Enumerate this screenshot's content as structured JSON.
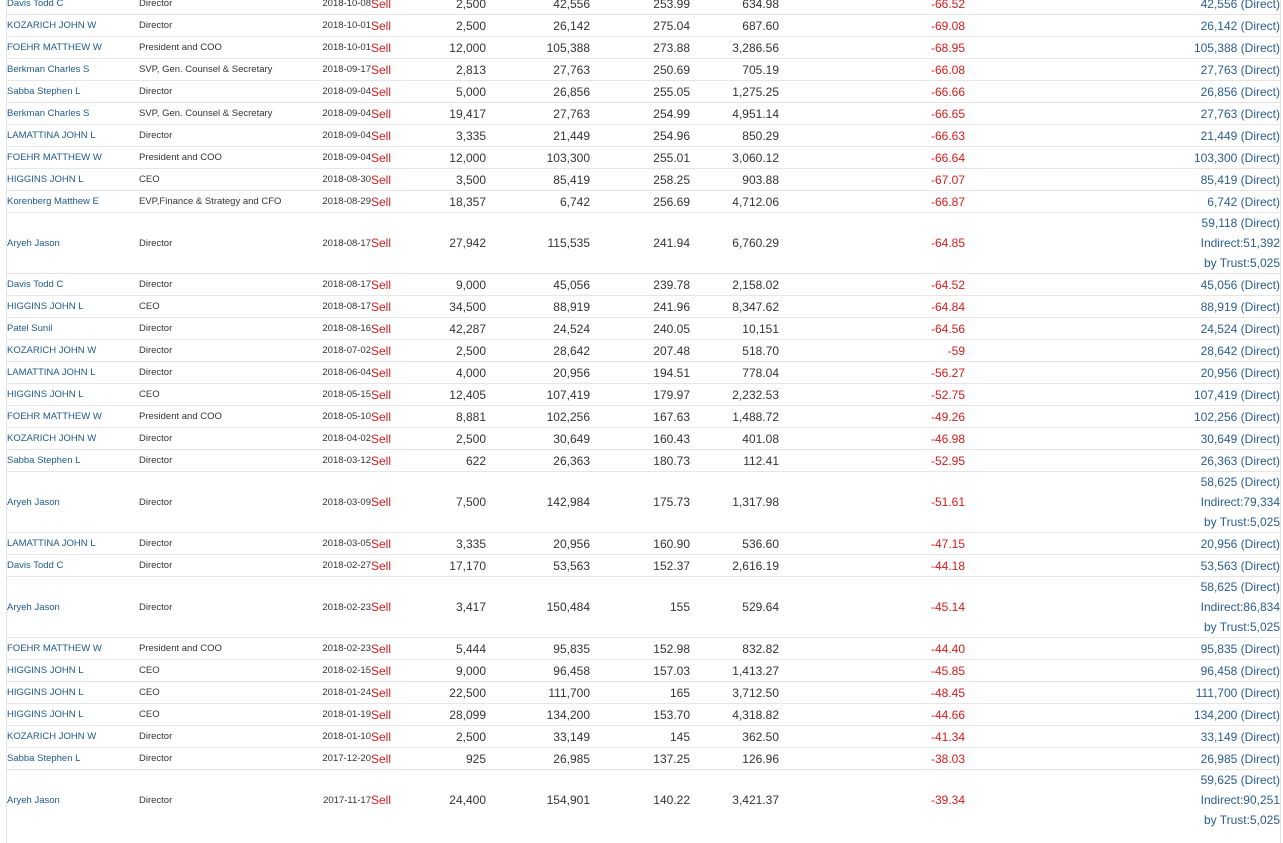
{
  "table": {
    "rows": [
      {
        "insider": "Davis Todd C",
        "relationship": "Director",
        "date": "2018-10-08",
        "type": "Sell",
        "shares": "2,500",
        "total": "42,556",
        "price": "253.99",
        "value": "634.98",
        "change": "-66.52",
        "owned": [
          "42,556 (Direct)"
        ]
      },
      {
        "insider": "KOZARICH JOHN W",
        "relationship": "Director",
        "date": "2018-10-01",
        "type": "Sell",
        "shares": "2,500",
        "total": "26,142",
        "price": "275.04",
        "value": "687.60",
        "change": "-69.08",
        "owned": [
          "26,142 (Direct)"
        ]
      },
      {
        "insider": "FOEHR MATTHEW W",
        "relationship": "President and COO",
        "date": "2018-10-01",
        "type": "Sell",
        "shares": "12,000",
        "total": "105,388",
        "price": "273.88",
        "value": "3,286.56",
        "change": "-68.95",
        "owned": [
          "105,388 (Direct)"
        ]
      },
      {
        "insider": "Berkman Charles S",
        "relationship": "SVP, Gen. Counsel & Secretary",
        "date": "2018-09-17",
        "type": "Sell",
        "shares": "2,813",
        "total": "27,763",
        "price": "250.69",
        "value": "705.19",
        "change": "-66.08",
        "owned": [
          "27,763 (Direct)"
        ]
      },
      {
        "insider": "Sabba Stephen L",
        "relationship": "Director",
        "date": "2018-09-04",
        "type": "Sell",
        "shares": "5,000",
        "total": "26,856",
        "price": "255.05",
        "value": "1,275.25",
        "change": "-66.66",
        "owned": [
          "26,856 (Direct)"
        ]
      },
      {
        "insider": "Berkman Charles S",
        "relationship": "SVP, Gen. Counsel & Secretary",
        "date": "2018-09-04",
        "type": "Sell",
        "shares": "19,417",
        "total": "27,763",
        "price": "254.99",
        "value": "4,951.14",
        "change": "-66.65",
        "owned": [
          "27,763 (Direct)"
        ]
      },
      {
        "insider": "LAMATTINA JOHN L",
        "relationship": "Director",
        "date": "2018-09-04",
        "type": "Sell",
        "shares": "3,335",
        "total": "21,449",
        "price": "254.96",
        "value": "850.29",
        "change": "-66.63",
        "owned": [
          "21,449 (Direct)"
        ]
      },
      {
        "insider": "FOEHR MATTHEW W",
        "relationship": "President and COO",
        "date": "2018-09-04",
        "type": "Sell",
        "shares": "12,000",
        "total": "103,300",
        "price": "255.01",
        "value": "3,060.12",
        "change": "-66.64",
        "owned": [
          "103,300 (Direct)"
        ]
      },
      {
        "insider": "HIGGINS JOHN L",
        "relationship": "CEO",
        "date": "2018-08-30",
        "type": "Sell",
        "shares": "3,500",
        "total": "85,419",
        "price": "258.25",
        "value": "903.88",
        "change": "-67.07",
        "owned": [
          "85,419 (Direct)"
        ]
      },
      {
        "insider": "Korenberg Matthew E",
        "relationship": "EVP,Finance & Strategy and CFO",
        "date": "2018-08-29",
        "type": "Sell",
        "shares": "18,357",
        "total": "6,742",
        "price": "256.69",
        "value": "4,712.06",
        "change": "-66.87",
        "owned": [
          "6,742 (Direct)"
        ]
      },
      {
        "insider": "Aryeh Jason",
        "relationship": "Director",
        "date": "2018-08-17",
        "type": "Sell",
        "shares": "27,942",
        "total": "115,535",
        "price": "241.94",
        "value": "6,760.29",
        "change": "-64.85",
        "owned": [
          "59,118 (Direct)",
          "Indirect:51,392",
          "by Trust:5,025"
        ]
      },
      {
        "insider": "Davis Todd C",
        "relationship": "Director",
        "date": "2018-08-17",
        "type": "Sell",
        "shares": "9,000",
        "total": "45,056",
        "price": "239.78",
        "value": "2,158.02",
        "change": "-64.52",
        "owned": [
          "45,056 (Direct)"
        ]
      },
      {
        "insider": "HIGGINS JOHN L",
        "relationship": "CEO",
        "date": "2018-08-17",
        "type": "Sell",
        "shares": "34,500",
        "total": "88,919",
        "price": "241.96",
        "value": "8,347.62",
        "change": "-64.84",
        "owned": [
          "88,919 (Direct)"
        ]
      },
      {
        "insider": "Patel Sunil",
        "relationship": "Director",
        "date": "2018-08-16",
        "type": "Sell",
        "shares": "42,287",
        "total": "24,524",
        "price": "240.05",
        "value": "10,151",
        "change": "-64.56",
        "owned": [
          "24,524 (Direct)"
        ]
      },
      {
        "insider": "KOZARICH JOHN W",
        "relationship": "Director",
        "date": "2018-07-02",
        "type": "Sell",
        "shares": "2,500",
        "total": "28,642",
        "price": "207.48",
        "value": "518.70",
        "change": "-59",
        "owned": [
          "28,642 (Direct)"
        ]
      },
      {
        "insider": "LAMATTINA JOHN L",
        "relationship": "Director",
        "date": "2018-06-04",
        "type": "Sell",
        "shares": "4,000",
        "total": "20,956",
        "price": "194.51",
        "value": "778.04",
        "change": "-56.27",
        "owned": [
          "20,956 (Direct)"
        ]
      },
      {
        "insider": "HIGGINS JOHN L",
        "relationship": "CEO",
        "date": "2018-05-15",
        "type": "Sell",
        "shares": "12,405",
        "total": "107,419",
        "price": "179.97",
        "value": "2,232.53",
        "change": "-52.75",
        "owned": [
          "107,419 (Direct)"
        ]
      },
      {
        "insider": "FOEHR MATTHEW W",
        "relationship": "President and COO",
        "date": "2018-05-10",
        "type": "Sell",
        "shares": "8,881",
        "total": "102,256",
        "price": "167.63",
        "value": "1,488.72",
        "change": "-49.26",
        "owned": [
          "102,256 (Direct)"
        ]
      },
      {
        "insider": "KOZARICH JOHN W",
        "relationship": "Director",
        "date": "2018-04-02",
        "type": "Sell",
        "shares": "2,500",
        "total": "30,649",
        "price": "160.43",
        "value": "401.08",
        "change": "-46.98",
        "owned": [
          "30,649 (Direct)"
        ]
      },
      {
        "insider": "Sabba Stephen L",
        "relationship": "Director",
        "date": "2018-03-12",
        "type": "Sell",
        "shares": "622",
        "total": "26,363",
        "price": "180.73",
        "value": "112.41",
        "change": "-52.95",
        "owned": [
          "26,363 (Direct)"
        ]
      },
      {
        "insider": "Aryeh Jason",
        "relationship": "Director",
        "date": "2018-03-09",
        "type": "Sell",
        "shares": "7,500",
        "total": "142,984",
        "price": "175.73",
        "value": "1,317.98",
        "change": "-51.61",
        "owned": [
          "58,625 (Direct)",
          "Indirect:79,334",
          "by Trust:5,025"
        ]
      },
      {
        "insider": "LAMATTINA JOHN L",
        "relationship": "Director",
        "date": "2018-03-05",
        "type": "Sell",
        "shares": "3,335",
        "total": "20,956",
        "price": "160.90",
        "value": "536.60",
        "change": "-47.15",
        "owned": [
          "20,956 (Direct)"
        ]
      },
      {
        "insider": "Davis Todd C",
        "relationship": "Director",
        "date": "2018-02-27",
        "type": "Sell",
        "shares": "17,170",
        "total": "53,563",
        "price": "152.37",
        "value": "2,616.19",
        "change": "-44.18",
        "owned": [
          "53,563 (Direct)"
        ]
      },
      {
        "insider": "Aryeh Jason",
        "relationship": "Director",
        "date": "2018-02-23",
        "type": "Sell",
        "shares": "3,417",
        "total": "150,484",
        "price": "155",
        "value": "529.64",
        "change": "-45.14",
        "owned": [
          "58,625 (Direct)",
          "Indirect:86,834",
          "by Trust:5,025"
        ]
      },
      {
        "insider": "FOEHR MATTHEW W",
        "relationship": "President and COO",
        "date": "2018-02-23",
        "type": "Sell",
        "shares": "5,444",
        "total": "95,835",
        "price": "152.98",
        "value": "832.82",
        "change": "-44.40",
        "owned": [
          "95,835 (Direct)"
        ]
      },
      {
        "insider": "HIGGINS JOHN L",
        "relationship": "CEO",
        "date": "2018-02-15",
        "type": "Sell",
        "shares": "9,000",
        "total": "96,458",
        "price": "157.03",
        "value": "1,413.27",
        "change": "-45.85",
        "owned": [
          "96,458 (Direct)"
        ]
      },
      {
        "insider": "HIGGINS JOHN L",
        "relationship": "CEO",
        "date": "2018-01-24",
        "type": "Sell",
        "shares": "22,500",
        "total": "111,700",
        "price": "165",
        "value": "3,712.50",
        "change": "-48.45",
        "owned": [
          "111,700 (Direct)"
        ]
      },
      {
        "insider": "HIGGINS JOHN L",
        "relationship": "CEO",
        "date": "2018-01-19",
        "type": "Sell",
        "shares": "28,099",
        "total": "134,200",
        "price": "153.70",
        "value": "4,318.82",
        "change": "-44.66",
        "owned": [
          "134,200 (Direct)"
        ]
      },
      {
        "insider": "KOZARICH JOHN W",
        "relationship": "Director",
        "date": "2018-01-10",
        "type": "Sell",
        "shares": "2,500",
        "total": "33,149",
        "price": "145",
        "value": "362.50",
        "change": "-41.34",
        "owned": [
          "33,149 (Direct)"
        ]
      },
      {
        "insider": "Sabba Stephen L",
        "relationship": "Director",
        "date": "2017-12-20",
        "type": "Sell",
        "shares": "925",
        "total": "26,985",
        "price": "137.25",
        "value": "126.96",
        "change": "-38.03",
        "owned": [
          "26,985 (Direct)"
        ]
      },
      {
        "insider": "Aryeh Jason",
        "relationship": "Director",
        "date": "2017-11-17",
        "type": "Sell",
        "shares": "24,400",
        "total": "154,901",
        "price": "140.22",
        "value": "3,421.37",
        "change": "-39.34",
        "owned": [
          "59,625 (Direct)",
          "Indirect:90,251",
          "by Trust:5,025"
        ]
      }
    ]
  }
}
